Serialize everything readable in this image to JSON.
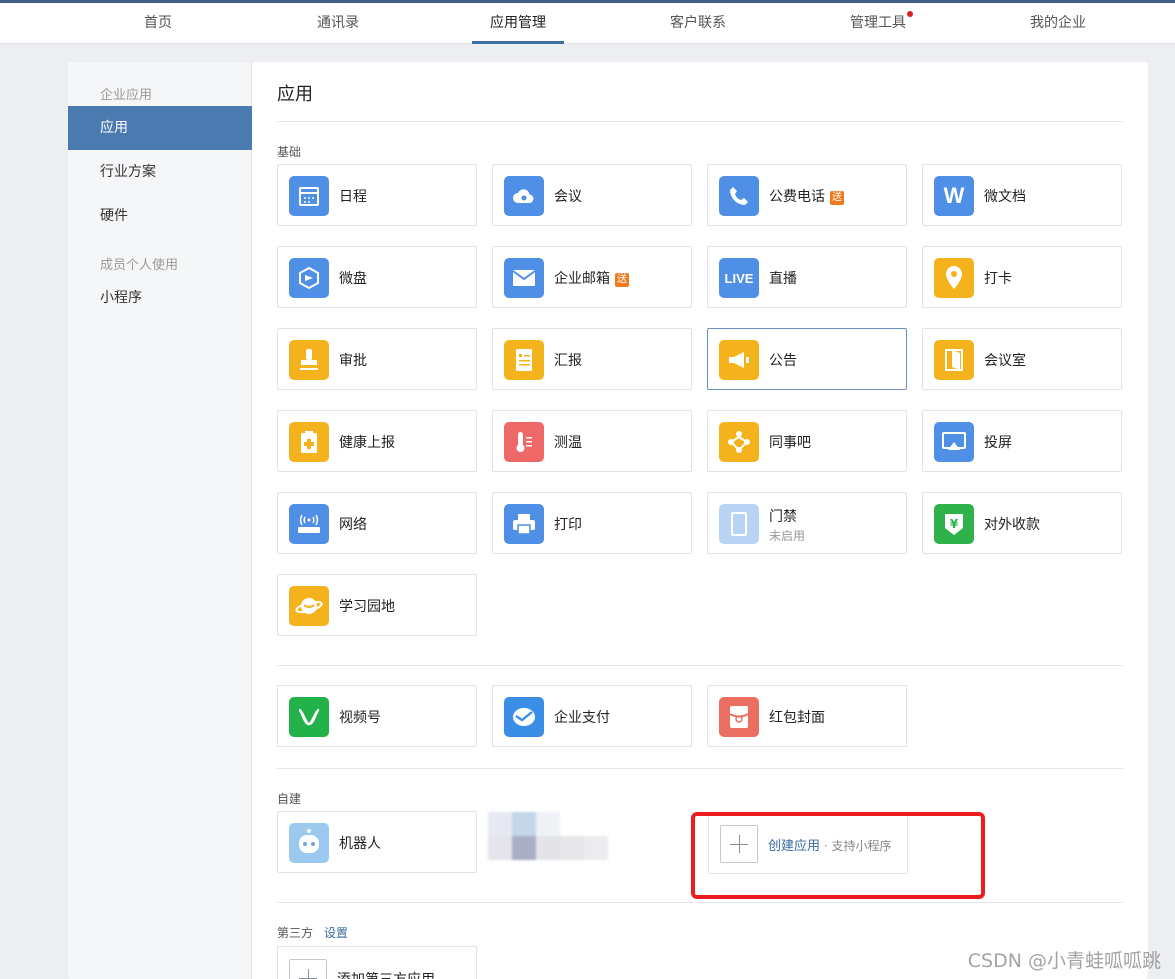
{
  "nav": {
    "items": [
      {
        "label": "首页"
      },
      {
        "label": "通讯录"
      },
      {
        "label": "应用管理"
      },
      {
        "label": "客户联系"
      },
      {
        "label": "管理工具"
      },
      {
        "label": "我的企业"
      }
    ],
    "active_index": 2,
    "dot_on_index": 4
  },
  "sidebar": {
    "group1": "企业应用",
    "items1": [
      {
        "label": "应用"
      },
      {
        "label": "行业方案"
      },
      {
        "label": "硬件"
      }
    ],
    "group2": "成员个人使用",
    "items2": [
      {
        "label": "小程序"
      }
    ]
  },
  "main": {
    "title": "应用",
    "basic_label": "基础",
    "apps": [
      {
        "name": "日程",
        "icon": "calendar-icon",
        "color": "#4f8fe6"
      },
      {
        "name": "会议",
        "icon": "cloud-meeting-icon",
        "color": "#4f8fe6"
      },
      {
        "name": "公费电话",
        "icon": "phone-icon",
        "color": "#4f8fe6",
        "badge": "送"
      },
      {
        "name": "微文档",
        "icon": "w-doc-icon",
        "color": "#4f8fe6"
      },
      {
        "name": "微盘",
        "icon": "drive-icon",
        "color": "#4f8fe6"
      },
      {
        "name": "企业邮箱",
        "icon": "mail-icon",
        "color": "#4f8fe6",
        "badge": "送"
      },
      {
        "name": "直播",
        "icon": "live-icon",
        "color": "#4f8fe6"
      },
      {
        "name": "打卡",
        "icon": "location-pin-icon",
        "color": "#f4b21c"
      },
      {
        "name": "审批",
        "icon": "stamp-icon",
        "color": "#f4b21c"
      },
      {
        "name": "汇报",
        "icon": "report-icon",
        "color": "#f4b21c"
      },
      {
        "name": "公告",
        "icon": "megaphone-icon",
        "color": "#f4b21c"
      },
      {
        "name": "会议室",
        "icon": "door-icon",
        "color": "#f4b21c"
      },
      {
        "name": "健康上报",
        "icon": "health-report-icon",
        "color": "#f4b21c"
      },
      {
        "name": "测温",
        "icon": "thermometer-icon",
        "color": "#ef6868"
      },
      {
        "name": "同事吧",
        "icon": "colleague-icon",
        "color": "#f4b21c"
      },
      {
        "name": "投屏",
        "icon": "screen-cast-icon",
        "color": "#4f8fe6"
      },
      {
        "name": "网络",
        "icon": "router-icon",
        "color": "#4f8fe6"
      },
      {
        "name": "打印",
        "icon": "printer-icon",
        "color": "#4f8fe6"
      },
      {
        "name": "门禁",
        "sub": "未启用",
        "icon": "access-control-icon",
        "color": "#b9d3f4"
      },
      {
        "name": "对外收款",
        "icon": "yuan-shield-icon",
        "color": "#2fb24a"
      },
      {
        "name": "学习园地",
        "icon": "planet-icon",
        "color": "#f4b21c"
      }
    ],
    "extra_apps": [
      {
        "name": "视频号",
        "icon": "channels-icon",
        "color": "#23b24a"
      },
      {
        "name": "企业支付",
        "icon": "pay-icon",
        "color": "#3a8ee6"
      },
      {
        "name": "红包封面",
        "icon": "red-packet-icon",
        "color": "#ea6f62"
      }
    ],
    "custom_label": "自建",
    "custom_apps": [
      {
        "name": "机器人",
        "icon": "robot-icon",
        "color": "#9cc9f0"
      }
    ],
    "create": {
      "label": "创建应用",
      "hint": " · 支持小程序"
    },
    "third_label": "第三方",
    "third_settings": "设置",
    "add_third": "添加第三方应用"
  },
  "watermark": "CSDN @小青蛙呱呱跳"
}
